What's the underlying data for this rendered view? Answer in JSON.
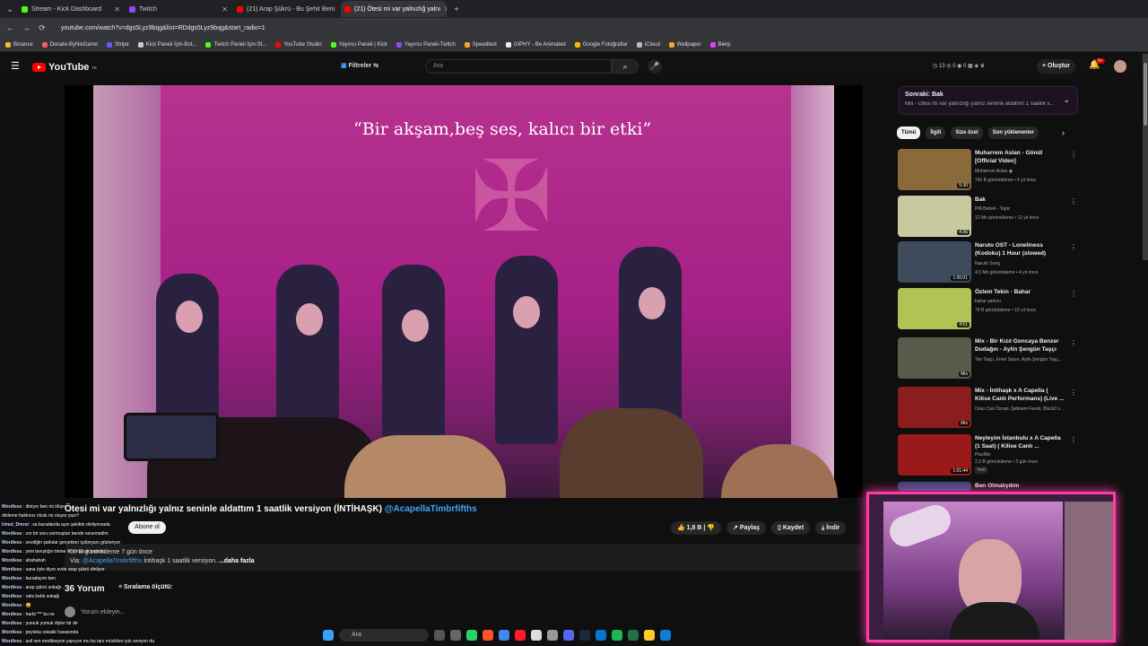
{
  "browser": {
    "tabs": [
      {
        "title": "Stream - Kick Dashboard",
        "color": "#53fc18"
      },
      {
        "title": "Twitch",
        "color": "#9146ff"
      },
      {
        "title": "(21) Arap Şükrü - Bu Şehir Beni",
        "color": "#ff0000"
      },
      {
        "title": "(21) Ötesi mi var yalnızlığ yalnı",
        "color": "#ff0000"
      }
    ],
    "url": "youtube.com/watch?v=dgs5Lyz9bqg&list=RDdgs5Lyz9bqg&start_radio=1",
    "bookmarks": [
      "Binance",
      "Donate-ByNixGame",
      "Stripe",
      "Kick Paneli İçin-Bot...",
      "Twitch Paneli İçin-St...",
      "YouTube Studio",
      "Yayıncı Paneli | Kick",
      "Yayıncı Paneli-Twitch",
      "Speedtest",
      "GIPHY - Be Animated",
      "Google Fotoğraflar",
      "iCloud",
      "Wallpaper",
      "Bierp"
    ]
  },
  "youtube": {
    "logo": "YouTube",
    "logo_sup": "TR",
    "filters": "Filtreler",
    "search_placeholder": "Ara",
    "create": "Oluştur",
    "notif_count": "9+"
  },
  "video": {
    "overlay_text": "“Bir akşam,beş ses, kalıcı bir etki”",
    "title": "Ötesi mi var yalnızlığı yalnız seninle aldattım 1 saatlik versiyon (İNTİHAŞK)",
    "handle": "@AcapellaTimbrfifths",
    "subscribe": "Abone ol",
    "likes": "1,8 B",
    "share": "Paylaş",
    "save": "Kaydet",
    "download": "İndir",
    "views": "57 B görüntüleme  7 gün önce",
    "description_prefix": "Via:",
    "description_handle": "@AcapellaTimbrfifths",
    "description_text": "İntihaşk 1 saatlik versiyon.",
    "more": "...daha fazla",
    "comments_count": "36 Yorum",
    "sort": "Sıralama ölçütü:",
    "add_comment": "Yorum ekleyin..."
  },
  "chat": [
    {
      "user": "Wordless",
      "msg": "diniyor ben mi ölüyor"
    },
    {
      "user": "",
      "msg": "dinleme hakkınız olcak ne oluyor yazı?"
    },
    {
      "user": "Umut_Dmrst",
      "msg": "sa buradanda aynı şekilde dinliyorsada"
    },
    {
      "user": "Wordless",
      "msg": "zor bir soru sormuştun bende sesemedim"
    },
    {
      "user": "Wordless",
      "msg": "sevdiğin şarkılar gerçekten içdünyanı gösteriyor"
    },
    {
      "user": "Wordless",
      "msg": "yeni tanıştığın birine ilk sorulcak şarkılar"
    },
    {
      "user": "Wordless",
      "msg": "ahahahah"
    },
    {
      "user": "Wordless",
      "msg": "sana öyle diyor evde arap şükrü dinliyor"
    },
    {
      "user": "Wordless",
      "msg": "buradayım ben"
    },
    {
      "user": "Wordless",
      "msg": "arap şükrü sokağı..."
    },
    {
      "user": "Wordless",
      "msg": "raks bebk sokağı"
    },
    {
      "user": "Wordless",
      "msg": "😅"
    },
    {
      "user": "Wordless",
      "msg": "harbi *** bu ne"
    },
    {
      "user": "Wordless",
      "msg": "yumuk yumuk diyler bir de"
    },
    {
      "user": "Wordless",
      "msg": "peyleka sokakk havasında"
    },
    {
      "user": "Wordless",
      "msg": "asil sen meditasyon yapıyon mu bu tarz müzikleri çok seviyon da"
    }
  ],
  "taskbar": {
    "search": "Ara"
  },
  "sidebar": {
    "upnext_label": "Sonraki: Bak",
    "upnext_sub": "Mix - Ötesi mi var yalnızlığı yalnız seninle aldattım 1 saatlik v...",
    "chips": [
      "Tümü",
      "İlgili",
      "Size özel",
      "Son yüklenenler"
    ],
    "items": [
      {
        "title": "Muharrem Aslan - Gönül [Official Video]",
        "channel": "Muharrem Aslan ◉",
        "meta": "741 B görüntüleme • 4 yıl önce",
        "duration": "5:30",
        "color": "#8a6a3a"
      },
      {
        "title": "Bak",
        "channel": "Pilli Bebek - Topic",
        "meta": "12 Mn görüntüleme • 11 yıl önce",
        "duration": "4:36",
        "color": "#c9c9a0"
      },
      {
        "title": "Naruto OST - Loneliness (Kodoku) 1 Hour (slowed)",
        "channel": "Naruto Song",
        "meta": "4,5 Mn görüntüleme • 4 yıl önce",
        "duration": "1:00:01",
        "color": "#3c4a5c"
      },
      {
        "title": "Özlem Tekin - Bahar",
        "channel": "bahar şarkısı",
        "meta": "79 B görüntüleme • 10 yıl önce",
        "duration": "4:51",
        "color": "#b3c254"
      },
      {
        "title": "Mix - Bir Kızıl Goncaya Benzer Dudağın - Aylin Şengün Taşçı",
        "channel": "Tan Taşçı, Emel Sayın, Aylin Şengün Taşç...",
        "meta": "",
        "duration": "Mix",
        "color": "#5a5a4a"
      },
      {
        "title": "Mix - İntihaşk x A Capella ( Kilise Canlı Performans) (Live ...",
        "channel": "Onur Can Özcan, Şebnem Ferah, Block3 v...",
        "meta": "",
        "duration": "Mix",
        "color": "#8c1d1d"
      },
      {
        "title": "Neyleyim İstanbulu x A Capella (1 Saat) ( Kilise Canlı ...",
        "channel": "PlusMix",
        "meta": "2,3 B görüntüleme • 3 gün önce",
        "badge": "Yeni",
        "duration": "1:01:44",
        "color": "#9a1a1a"
      },
      {
        "title": "Ben Olmalıydım",
        "channel": "",
        "meta": "",
        "duration": "",
        "color": "#324a7a"
      }
    ]
  }
}
